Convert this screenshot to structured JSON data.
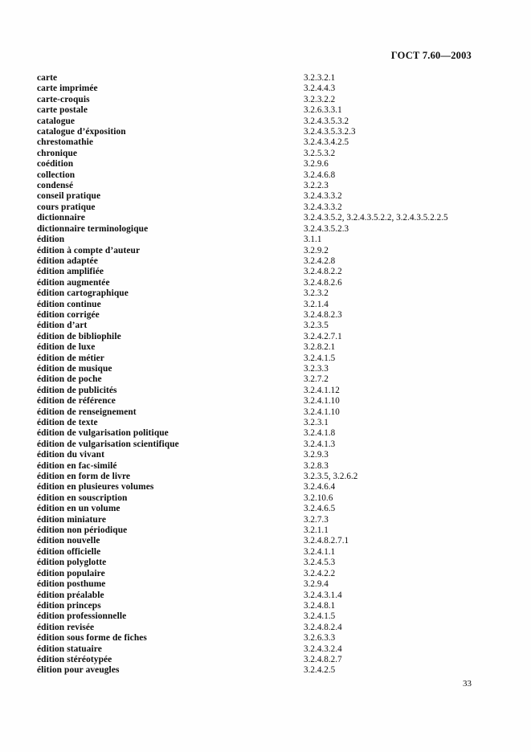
{
  "header": {
    "standard_number": "ГОСТ 7.60—2003"
  },
  "footer": {
    "page_number": "33"
  },
  "index": {
    "entries": [
      {
        "term": "carte",
        "refs": "3.2.3.2.1"
      },
      {
        "term": "carte imprimée",
        "refs": "3.2.4.4.3"
      },
      {
        "term": "carte-croquis",
        "refs": "3.2.3.2.2"
      },
      {
        "term": "carte postale",
        "refs": "3.2.6.3.3.1"
      },
      {
        "term": "catalogue",
        "refs": "3.2.4.3.5.3.2"
      },
      {
        "term": "catalogue d’éxposition",
        "refs": "3.2.4.3.5.3.2.3"
      },
      {
        "term": "chrestomathie",
        "refs": "3.2.4.3.4.2.5"
      },
      {
        "term": "chronique",
        "refs": "3.2.5.3.2"
      },
      {
        "term": "coédition",
        "refs": "3.2.9.6"
      },
      {
        "term": "collection",
        "refs": "3.2.4.6.8"
      },
      {
        "term": "condensé",
        "refs": "3.2.2.3"
      },
      {
        "term": "conseil pratique",
        "refs": "3.2.4.3.3.2"
      },
      {
        "term": "cours pratique",
        "refs": "3.2.4.3.3.2"
      },
      {
        "term": "dictionnaire",
        "refs": "3.2.4.3.5.2, 3.2.4.3.5.2.2, 3.2.4.3.5.2.2.5"
      },
      {
        "term": "dictionnaire terminologique",
        "refs": "3.2.4.3.5.2.3"
      },
      {
        "term": "édition",
        "refs": "3.1.1"
      },
      {
        "term": "édition à compte d’auteur",
        "refs": "3.2.9.2"
      },
      {
        "term": "édition adaptée",
        "refs": "3.2.4.2.8"
      },
      {
        "term": "édition amplifiée",
        "refs": "3.2.4.8.2.2"
      },
      {
        "term": "édition augmentée",
        "refs": "3.2.4.8.2.6"
      },
      {
        "term": "édition cartographique",
        "refs": "3.2.3.2"
      },
      {
        "term": "édition continue",
        "refs": "3.2.1.4"
      },
      {
        "term": "édition corrigée",
        "refs": "3.2.4.8.2.3"
      },
      {
        "term": "édition d’art",
        "refs": "3.2.3.5"
      },
      {
        "term": "édition de bibliophile",
        "refs": "3.2.4.2.7.1"
      },
      {
        "term": "édition de luxe",
        "refs": "3.2.8.2.1"
      },
      {
        "term": "édition de métier",
        "refs": "3.2.4.1.5"
      },
      {
        "term": "édition de musique",
        "refs": "3.2.3.3"
      },
      {
        "term": "édition de poche",
        "refs": "3.2.7.2"
      },
      {
        "term": "édition de publicités",
        "refs": "3.2.4.1.12"
      },
      {
        "term": "édition de référence",
        "refs": "3.2.4.1.10"
      },
      {
        "term": "édition de renseignement",
        "refs": "3.2.4.1.10"
      },
      {
        "term": "édition de texte",
        "refs": "3.2.3.1"
      },
      {
        "term": "édition de vulgarisation politique",
        "refs": "3.2.4.1.8"
      },
      {
        "term": "édition de vulgarisation scientifique",
        "refs": "3.2.4.1.3"
      },
      {
        "term": "édition du vivant",
        "refs": "3.2.9.3"
      },
      {
        "term": "édition en fac-similé",
        "refs": "3.2.8.3"
      },
      {
        "term": "édition en form de livre",
        "refs": "3.2.3.5, 3.2.6.2"
      },
      {
        "term": "édition en plusieures volumes",
        "refs": "3.2.4.6.4"
      },
      {
        "term": "édition en souscription",
        "refs": "3.2.10.6"
      },
      {
        "term": "édition en un volume",
        "refs": "3.2.4.6.5"
      },
      {
        "term": "édition miniature",
        "refs": "3.2.7.3"
      },
      {
        "term": "édition non périodique",
        "refs": "3.2.1.1"
      },
      {
        "term": "édition nouvelle",
        "refs": "3.2.4.8.2.7.1"
      },
      {
        "term": "édition officielle",
        "refs": "3.2.4.1.1"
      },
      {
        "term": "édition polyglotte",
        "refs": "3.2.4.5.3"
      },
      {
        "term": "édition populaire",
        "refs": "3.2.4.2.2"
      },
      {
        "term": "édition posthume",
        "refs": "3.2.9.4"
      },
      {
        "term": "édition préalable",
        "refs": "3.2.4.3.1.4"
      },
      {
        "term": "édition princeps",
        "refs": "3.2.4.8.1"
      },
      {
        "term": "édition professionnelle",
        "refs": "3.2.4.1.5"
      },
      {
        "term": "édition revisée",
        "refs": "3.2.4.8.2.4"
      },
      {
        "term": "édition sous forme de fiches",
        "refs": "3.2.6.3.3"
      },
      {
        "term": "édition statuaire",
        "refs": "3.2.4.3.2.4"
      },
      {
        "term": "édition stéréotypée",
        "refs": "3.2.4.8.2.7"
      },
      {
        "term": "élition pour aveugles",
        "refs": "3.2.4.2.5"
      }
    ]
  }
}
